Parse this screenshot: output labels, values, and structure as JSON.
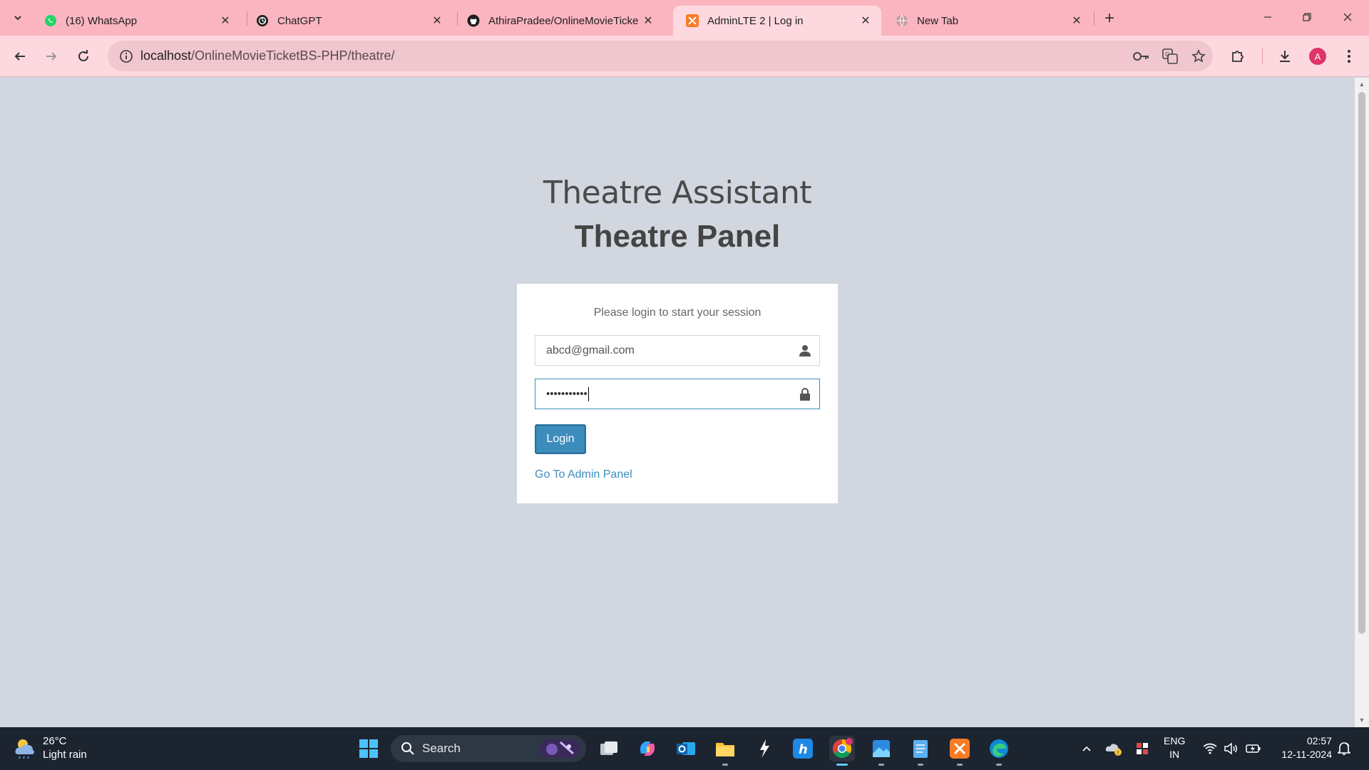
{
  "browser": {
    "tabs": [
      {
        "title": "(16) WhatsApp",
        "icon": "whatsapp-icon"
      },
      {
        "title": "ChatGPT",
        "icon": "chatgpt-icon"
      },
      {
        "title": "AthiraPradee/OnlineMovieTicke",
        "icon": "github-icon"
      },
      {
        "title": "AdminLTE 2 | Log in",
        "icon": "xampp-icon",
        "active": true
      },
      {
        "title": "New Tab",
        "icon": "globe-icon"
      }
    ],
    "url_host": "localhost",
    "url_path": "/OnlineMovieTicketBS-PHP/theatre/",
    "profile_initial": "A"
  },
  "page": {
    "logo_light": "Theatre Assistant",
    "logo_bold": "Theatre Panel",
    "login_msg": "Please login to start your session",
    "email_value": "abcd@gmail.com",
    "password_mask": "•••••••••••",
    "login_button": "Login",
    "admin_link": "Go To Admin Panel"
  },
  "taskbar": {
    "weather_temp": "26°C",
    "weather_desc": "Light rain",
    "search_label": "Search",
    "lang_line1": "ENG",
    "lang_line2": "IN",
    "time": "02:57",
    "date": "12-11-2024"
  },
  "colors": {
    "tabstrip": "#fbb5c1",
    "toolbar": "#fdd9df",
    "page_bg": "#d2d6de",
    "primary": "#3c8dbc",
    "taskbar": "#1c2430"
  }
}
